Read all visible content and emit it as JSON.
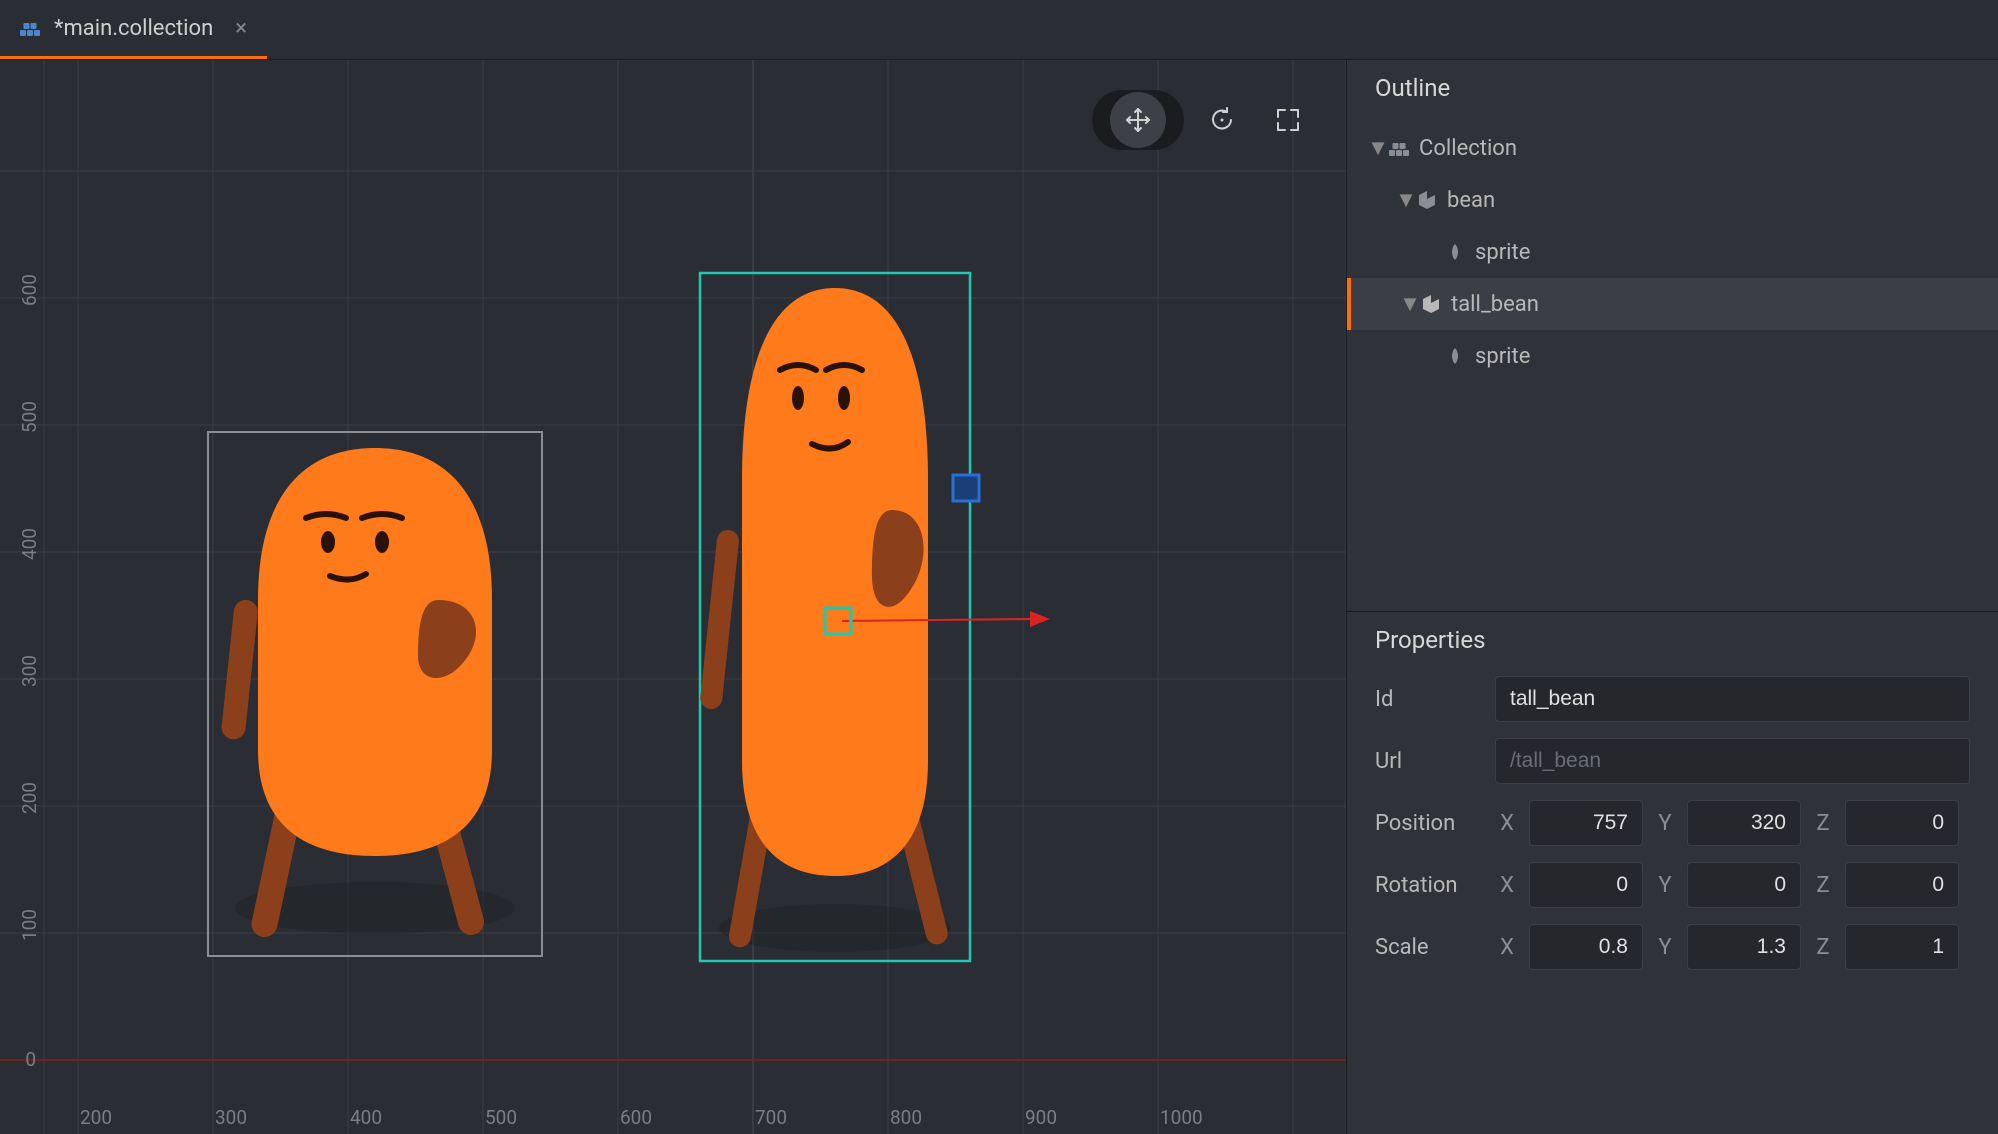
{
  "tab": {
    "title": "*main.collection",
    "icon": "collection-icon"
  },
  "viewport": {
    "y_ticks": [
      "0",
      "100",
      "200",
      "300",
      "400",
      "500",
      "600"
    ],
    "x_ticks": [
      "200",
      "300",
      "400",
      "500",
      "600",
      "700",
      "800",
      "900",
      "1000"
    ],
    "tools": {
      "move": "move",
      "rotate": "rotate",
      "scale": "scale"
    }
  },
  "outline": {
    "title": "Outline",
    "tree": {
      "root": {
        "label": "Collection",
        "type": "collection"
      },
      "bean": {
        "label": "bean",
        "type": "go"
      },
      "bean_sprite": {
        "label": "sprite",
        "type": "sprite"
      },
      "tall_bean": {
        "label": "tall_bean",
        "type": "go",
        "selected": true
      },
      "tall_sprite": {
        "label": "sprite",
        "type": "sprite"
      }
    }
  },
  "properties": {
    "title": "Properties",
    "id_label": "Id",
    "id_value": "tall_bean",
    "url_label": "Url",
    "url_value": "/tall_bean",
    "position_label": "Position",
    "position": {
      "x": "757",
      "y": "320",
      "z": "0"
    },
    "rotation_label": "Rotation",
    "rotation": {
      "x": "0",
      "y": "0",
      "z": "0"
    },
    "scale_label": "Scale",
    "scale": {
      "x": "0.8",
      "y": "1.3",
      "z": "1"
    },
    "axis": {
      "x": "X",
      "y": "Y",
      "z": "Z"
    }
  }
}
